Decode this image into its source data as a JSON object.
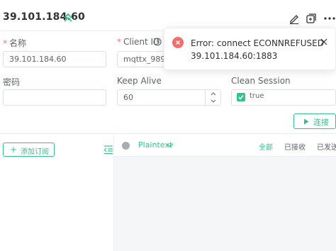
{
  "header": {
    "title": "39.101.184.60",
    "icons": [
      "chevrons-up-icon",
      "edit-icon",
      "new-window-icon",
      "more-icon"
    ]
  },
  "form": {
    "name_label": "名称",
    "name_value": "39.101.184.60",
    "client_id_label": "Client ID",
    "client_id_value": "mqttx_989ee3",
    "password_label": "密码",
    "password_value": "",
    "keep_alive_label": "Keep Alive",
    "keep_alive_value": "60",
    "clean_session_label": "Clean Session",
    "clean_session_value": "true",
    "connect_label": "连接"
  },
  "sidebar": {
    "add_subscription_label": "添加订阅"
  },
  "messages": {
    "format": "Plaintext",
    "filter_all": "全部",
    "filter_received": "已接收",
    "filter_sent": "已发送"
  },
  "toast": {
    "message": "Error: connect ECONNREFUSED 39.101.184.60:1883"
  },
  "colors": {
    "accent": "#34c388",
    "error": "#f56c6c",
    "border": "#dcdfe6",
    "panel_bg": "#f5f6f7"
  }
}
